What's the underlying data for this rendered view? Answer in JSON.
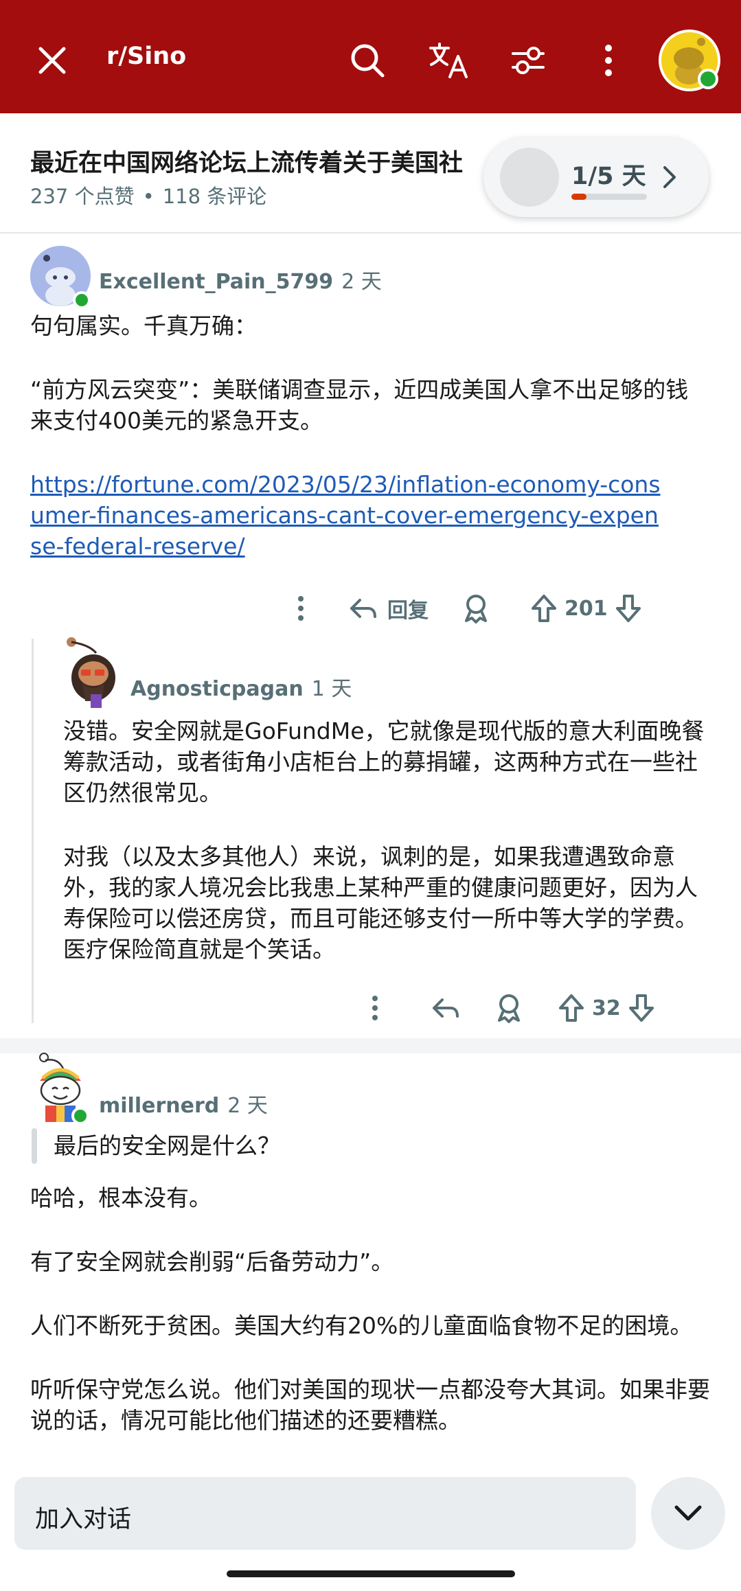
{
  "top_bar": {
    "subreddit": "r/Sino",
    "icons": [
      "close-icon",
      "search-icon",
      "translate-icon",
      "filter-icon",
      "more-icon",
      "avatar"
    ],
    "bg_color": "#a30d0d"
  },
  "post": {
    "title": "最近在中国网络论坛上流传着关于美国社",
    "upvotes": "237 个点赞",
    "comments": "118 条评论",
    "separator": "•"
  },
  "pager": {
    "label": "1/5 天",
    "progress_fraction": 0.2,
    "progress_color": "#d93a00"
  },
  "comments": [
    {
      "user": "Excellent_Pain_5799",
      "age": "2 天",
      "paragraphs": [
        "句句属实。千真万确：",
        "“前方风云突变”：美联储调查显示，近四成美国人拿不出足够的钱来支付400美元的紧急开支。"
      ],
      "link": "https://fortune.com/2023/05/23/inflation-economy-consumer-finances-americans-cant-cover-emergency-expense-federal-reserve/",
      "reply_label": "回复",
      "votes": "201"
    },
    {
      "user": "Agnosticpagan",
      "age": "1 天",
      "paragraphs": [
        "没错。安全网就是GoFundMe，它就像是现代版的意大利面晚餐筹款活动，或者街角小店柜台上的募捐罐，这两种方式在一些社区仍然很常见。",
        "对我（以及太多其他人）来说，讽刺的是，如果我遭遇致命意外，我的家人境况会比我患上某种严重的健康问题更好，因为人寿保险可以偿还房贷，而且可能还够支付一所中等大学的学费。医疗保险简直就是个笑话。"
      ],
      "votes": "32"
    },
    {
      "user": "millernerd",
      "age": "2 天",
      "quote": "最后的安全网是什么？",
      "paragraphs": [
        "哈哈，根本没有。",
        "有了安全网就会削弱“后备劳动力”。",
        "人们不断死于贫困。美国大约有20%的儿童面临食物不足的困境。",
        "听听保守党怎么说。他们对美国的现状一点都没夸大其词。如果非要说的话，情况可能比他们描述的还要糟糕。"
      ]
    }
  ],
  "bottom": {
    "join_label": "加入对话",
    "collapse_icon": "chevron-down-icon"
  }
}
